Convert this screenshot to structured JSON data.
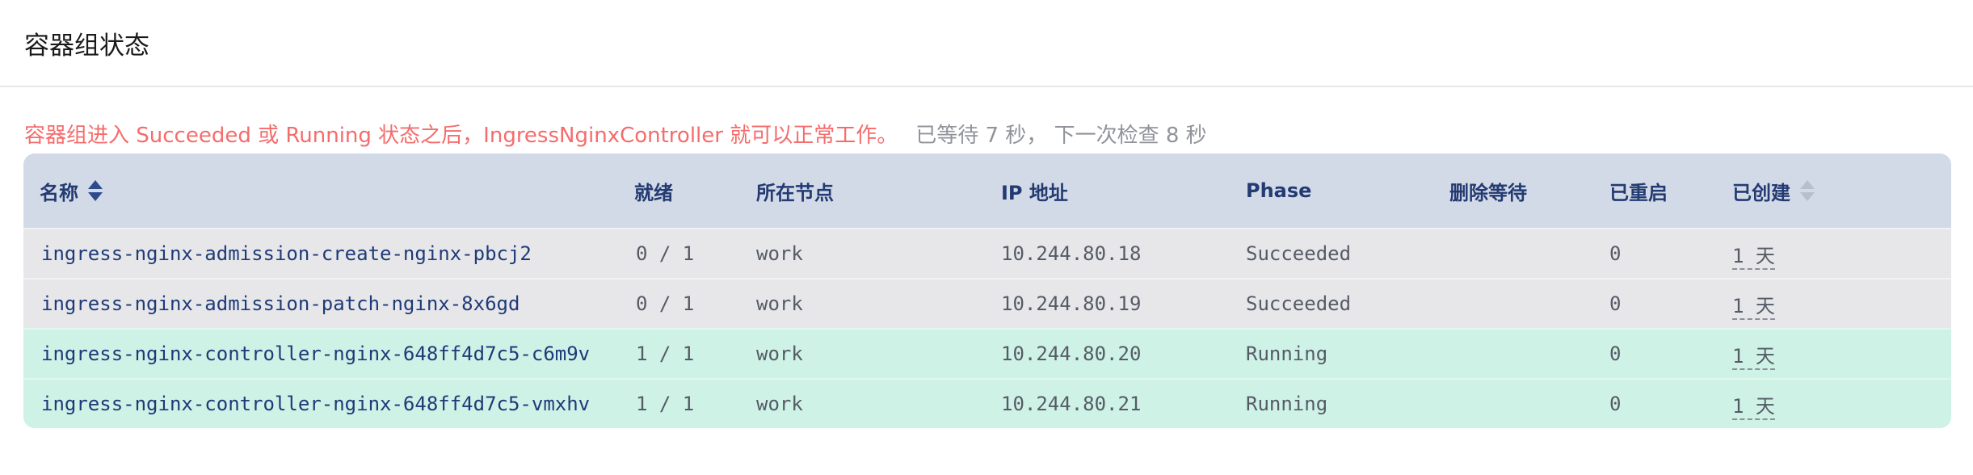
{
  "header": {
    "title": "容器组状态"
  },
  "notice": {
    "message": "容器组进入 Succeeded 或 Running 状态之后，IngressNginxController 就可以正常工作。",
    "waiting": "已等待 7 秒， 下一次检查 8 秒"
  },
  "table": {
    "columns": [
      "名称",
      "就绪",
      "所在节点",
      "IP 地址",
      "Phase",
      "删除等待",
      "已重启",
      "已创建"
    ],
    "rows": [
      {
        "name": "ingress-nginx-admission-create-nginx-pbcj2",
        "ready": "0 / 1",
        "node": "work",
        "ip": "10.244.80.18",
        "phase": "Succeeded",
        "deletion": "",
        "restarts": "0",
        "created": "1 天"
      },
      {
        "name": "ingress-nginx-admission-patch-nginx-8x6gd",
        "ready": "0 / 1",
        "node": "work",
        "ip": "10.244.80.19",
        "phase": "Succeeded",
        "deletion": "",
        "restarts": "0",
        "created": "1 天"
      },
      {
        "name": "ingress-nginx-controller-nginx-648ff4d7c5-c6m9v",
        "ready": "1 / 1",
        "node": "work",
        "ip": "10.244.80.20",
        "phase": "Running",
        "deletion": "",
        "restarts": "0",
        "created": "1 天"
      },
      {
        "name": "ingress-nginx-controller-nginx-648ff4d7c5-vmxhv",
        "ready": "1 / 1",
        "node": "work",
        "ip": "10.244.80.21",
        "phase": "Running",
        "deletion": "",
        "restarts": "0",
        "created": "1 天"
      }
    ]
  },
  "colors": {
    "warning_text": "#f56c6c",
    "header_bg": "#d3dae7",
    "succeeded_row_bg": "#e7e7ea",
    "running_row_bg": "#cef2e6"
  },
  "icons": {
    "sort": "sort-caret-icon"
  }
}
